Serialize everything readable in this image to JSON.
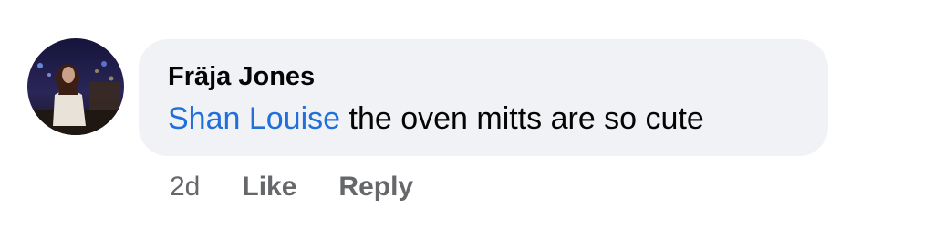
{
  "comment": {
    "author": "Fräja Jones",
    "mention": "Shan Louise",
    "text": " the oven mitts are so cute",
    "timestamp": "2d",
    "actions": {
      "like_label": "Like",
      "reply_label": "Reply"
    }
  },
  "colors": {
    "bubble_bg": "#f0f2f5",
    "mention": "#216fdb",
    "meta_text": "#65676b",
    "primary_text": "#050505"
  }
}
